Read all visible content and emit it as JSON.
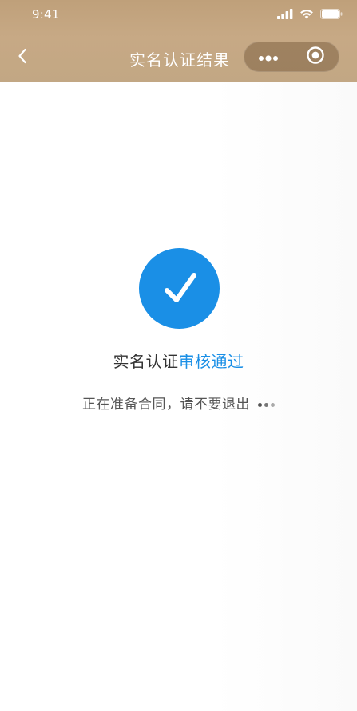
{
  "status_bar": {
    "time": "9:41",
    "icons": [
      "signal-icon",
      "wifi-icon",
      "battery-icon"
    ]
  },
  "nav": {
    "title": "实名认证结果",
    "back_icon": "chevron-left-icon",
    "more_icon": "more-dots-icon",
    "close_icon": "mini-program-close-icon"
  },
  "result": {
    "icon": "check-circle-icon",
    "title_prefix": "实名认证",
    "title_highlight": "审核通过",
    "subtitle": "正在准备合同，请不要退出",
    "loading_icon": "loading-dots-icon"
  },
  "colors": {
    "header_bg": "#c4a47f",
    "accent": "#1a8fe6",
    "title_text": "#333333",
    "sub_text": "#555555"
  }
}
